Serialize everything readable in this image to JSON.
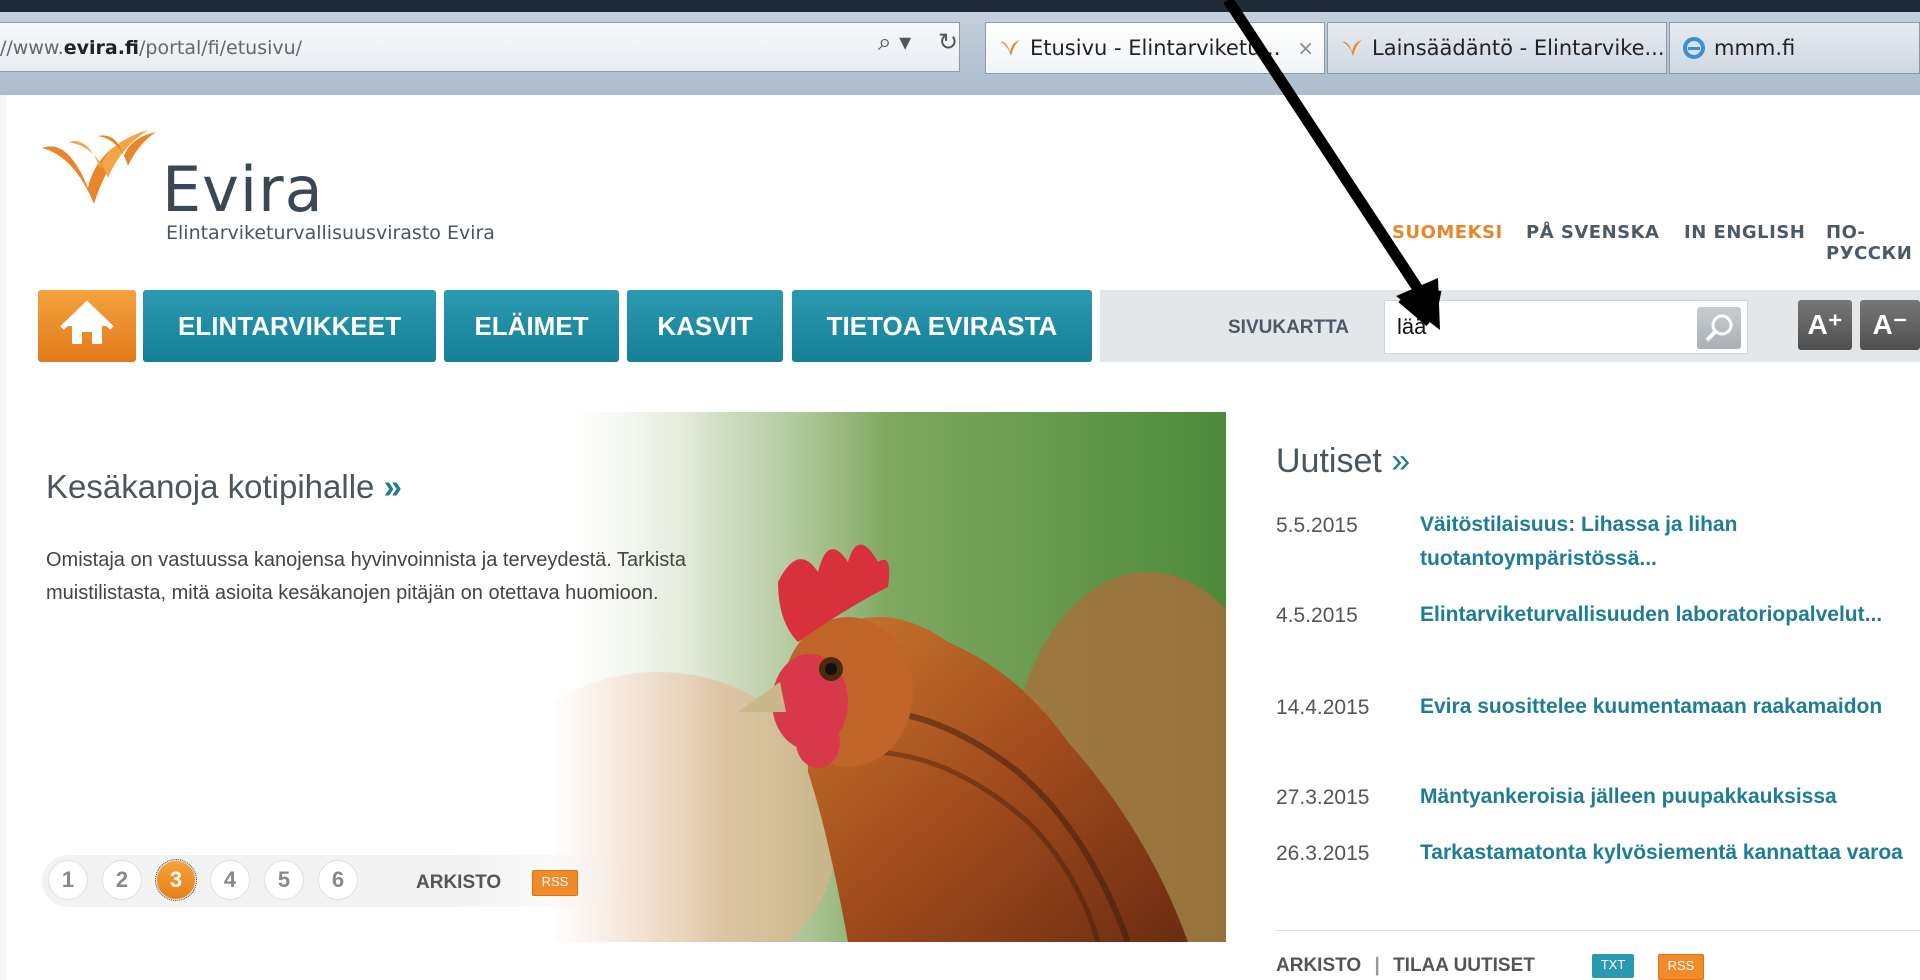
{
  "browser": {
    "url_prefix": "//www.",
    "url_domain": "evira.fi",
    "url_path": "/portal/fi/etusivu/",
    "tabs": [
      {
        "label": "Etusivu - Elintarviketu...",
        "close": "×"
      },
      {
        "label": "Lainsäädäntö - Elintarvike..."
      },
      {
        "label": "mmm.fi"
      }
    ],
    "search_glyph": "⌕ ▾",
    "refresh_glyph": "↻"
  },
  "logo": {
    "name": "Evira",
    "subtitle": "Elintarviketurvallisuusvirasto Evira"
  },
  "languages": [
    "SUOMEKSI",
    "PÅ SVENSKA",
    "IN ENGLISH",
    "ПО-РУССКИ"
  ],
  "nav": {
    "items": [
      "ELINTARVIKKEET",
      "ELÄIMET",
      "KASVIT",
      "TIETOA EVIRASTA"
    ],
    "sitemap": "SIVUKARTTA",
    "search_value": "lää",
    "font_larger": "A⁺",
    "font_smaller": "A⁻"
  },
  "hero": {
    "title": "Kesäkanoja kotipihalle",
    "title_arrow": "»",
    "text": "Omistaja on vastuussa kanojensa hyvinvoinnista ja terveydestä. Tarkista muistilistasta, mitä asioita kesäkanojen pitäjän on otettava huomioon.",
    "pages": [
      "1",
      "2",
      "3",
      "4",
      "5",
      "6"
    ],
    "active_page": "3",
    "archive": "ARKISTO",
    "rss": "RSS"
  },
  "news": {
    "title": "Uutiset",
    "title_arrow": "»",
    "items": [
      {
        "date": "5.5.2015",
        "text": "Väitöstilaisuus: Lihassa ja lihan tuotantoympäristössä..."
      },
      {
        "date": "4.5.2015",
        "text": "Elintarviketurvallisuuden laboratoriopalvelut..."
      },
      {
        "date": "14.4.2015",
        "text": "Evira suosittelee kuumentamaan raakamaidon"
      },
      {
        "date": "27.3.2015",
        "text": "Mäntyankeroisia jälleen puupakkauksissa"
      },
      {
        "date": "26.3.2015",
        "text": "Tarkastamatonta kylvösiementä kannattaa varoa"
      }
    ],
    "archive": "ARKISTO",
    "separator": "|",
    "subscribe": "TILAA UUTISET",
    "txt": "TXT",
    "rss": "RSS"
  },
  "colors": {
    "brand_teal": "#1e7d95",
    "brand_orange": "#e8862a"
  }
}
